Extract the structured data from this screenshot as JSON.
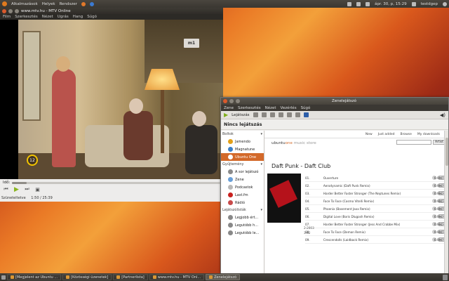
{
  "topbar": {
    "menus": [
      "Alkalmazások",
      "Helyek",
      "Rendszer"
    ],
    "clock": "ápr. 30, p, 15:29",
    "user": "testdgep"
  },
  "video_window": {
    "title": "www.mtv.hu - MTV Online",
    "menu": [
      "Film",
      "Szerkesztés",
      "Nézet",
      "Ugrás",
      "Hang",
      "Súgó"
    ],
    "channel_logo": "m1",
    "age_rating": "12",
    "seek_label": "Idő:",
    "status": "Szüneteltetve",
    "time": "1:50 / 25:39",
    "progress": 0.07
  },
  "music_window": {
    "title": "Zenelejátszó",
    "menu": [
      "Zene",
      "Szerkesztés",
      "Nézet",
      "Vezérlés",
      "Súgó"
    ],
    "play_label": "Lejátszás",
    "now_playing": "Nincs lejátszás",
    "sidebar": {
      "sections": [
        {
          "title": "Boltok",
          "items": [
            {
              "label": "Jamendo",
              "color": "#e2a019",
              "selected": false
            },
            {
              "label": "Magnatune",
              "color": "#3a7fc8",
              "selected": false
            },
            {
              "label": "Ubuntu One",
              "color": "#d36a2a",
              "selected": true
            }
          ]
        },
        {
          "title": "Gyűjtemény",
          "items": [
            {
              "label": "A sor lejátszó",
              "color": "#8a8a8a",
              "selected": false
            },
            {
              "label": "Zene",
              "color": "#6aa0d8",
              "selected": false
            },
            {
              "label": "Podcastok",
              "color": "#b8b8b8",
              "selected": false
            },
            {
              "label": "Last.fm",
              "color": "#c8201e",
              "selected": false
            },
            {
              "label": "Rádió",
              "color": "#c84a4a",
              "selected": false
            }
          ]
        },
        {
          "title": "Lejátszólisták",
          "items": [
            {
              "label": "Legjobb ért...",
              "color": "#888888",
              "selected": false
            },
            {
              "label": "Legutóbb h...",
              "color": "#888888",
              "selected": false
            },
            {
              "label": "Legutóbb le...",
              "color": "#888888",
              "selected": false
            }
          ]
        }
      ]
    },
    "store": {
      "nav": [
        "New",
        "Just added",
        "Browse",
        "My downloads"
      ],
      "brand_a": "ubuntu",
      "brand_b": "one",
      "brand_c": "music store",
      "search_button": "Artist",
      "album": "Daft Punk - Daft Club",
      "download_label": "Download",
      "tracks": [
        {
          "n": "01.",
          "title": "Ouverture",
          "price": "0.99€"
        },
        {
          "n": "02.",
          "title": "Aerodynamic (Daft Punk Remix)",
          "price": "0.99€"
        },
        {
          "n": "03.",
          "title": "Harder Better Faster Stronger (The Neptunes Remix)",
          "price": "0.99€"
        },
        {
          "n": "04.",
          "title": "Face To Face (Cosmo Vitelli Remix)",
          "price": "0.99€"
        },
        {
          "n": "05.",
          "title": "Phoenix (Basement Jaxx Remix)",
          "price": "0.99€"
        },
        {
          "n": "06.",
          "title": "Digital Love (Boris Dlugosh Remix)",
          "price": "0.99€"
        },
        {
          "n": "07.",
          "title": "Harder Better Faster Stronger (Jess And Crabbe Mix)",
          "price": "0.99€"
        },
        {
          "n": "08.",
          "title": "Face To Face (Demon Remix)",
          "price": "0.99€"
        },
        {
          "n": "09.",
          "title": "Crescendolls (Laidback Remix)",
          "price": "0.99€"
        }
      ],
      "meta_line1": "2:2003",
      "meta_line2": "3:02"
    }
  },
  "taskbar": [
    {
      "label": "[Megjelent az Ubuntu ...",
      "active": false
    },
    {
      "label": "[Közösségi üzenetek]",
      "active": false
    },
    {
      "label": "[Partnerlista]",
      "active": false
    },
    {
      "label": "www.mtv.hu - MTV Onl...",
      "active": false
    },
    {
      "label": "Zenelejátszó",
      "active": true
    }
  ]
}
